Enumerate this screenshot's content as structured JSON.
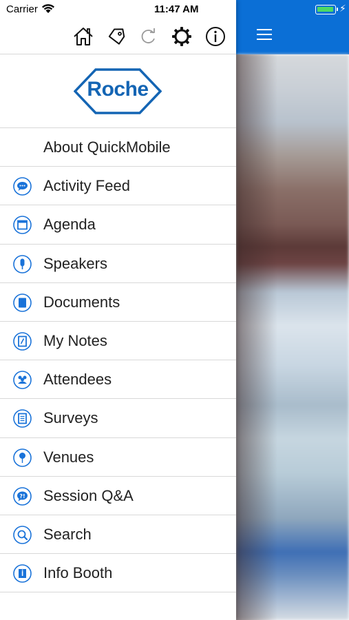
{
  "status_bar": {
    "carrier": "Carrier",
    "time": "11:47 AM",
    "battery_level": 1.0,
    "wifi_icon": "wifi-icon",
    "charging_icon": "charging-bolt-icon"
  },
  "toolbar": {
    "icons": [
      "home-icon",
      "tag-icon",
      "refresh-icon",
      "settings-gear-icon",
      "info-icon"
    ]
  },
  "logo": {
    "text": "Roche"
  },
  "main_header": {
    "menu_icon": "hamburger-menu-icon"
  },
  "colors": {
    "brand_blue": "#0b6fd6",
    "logo_blue": "#1465b4",
    "icon_blue": "#1a73d9"
  },
  "menu": {
    "items": [
      {
        "label": "About QuickMobile",
        "icon": ""
      },
      {
        "label": "Activity Feed",
        "icon": "chat-bubble-icon"
      },
      {
        "label": "Agenda",
        "icon": "calendar-icon"
      },
      {
        "label": "Speakers",
        "icon": "microphone-icon"
      },
      {
        "label": "Documents",
        "icon": "document-icon"
      },
      {
        "label": "My Notes",
        "icon": "notepad-icon"
      },
      {
        "label": "Attendees",
        "icon": "people-icon"
      },
      {
        "label": "Surveys",
        "icon": "clipboard-icon"
      },
      {
        "label": "Venues",
        "icon": "map-pin-icon"
      },
      {
        "label": "Session Q&A",
        "icon": "question-bubble-icon"
      },
      {
        "label": "Search",
        "icon": "search-icon"
      },
      {
        "label": "Info Booth",
        "icon": "info-booth-icon"
      }
    ]
  }
}
